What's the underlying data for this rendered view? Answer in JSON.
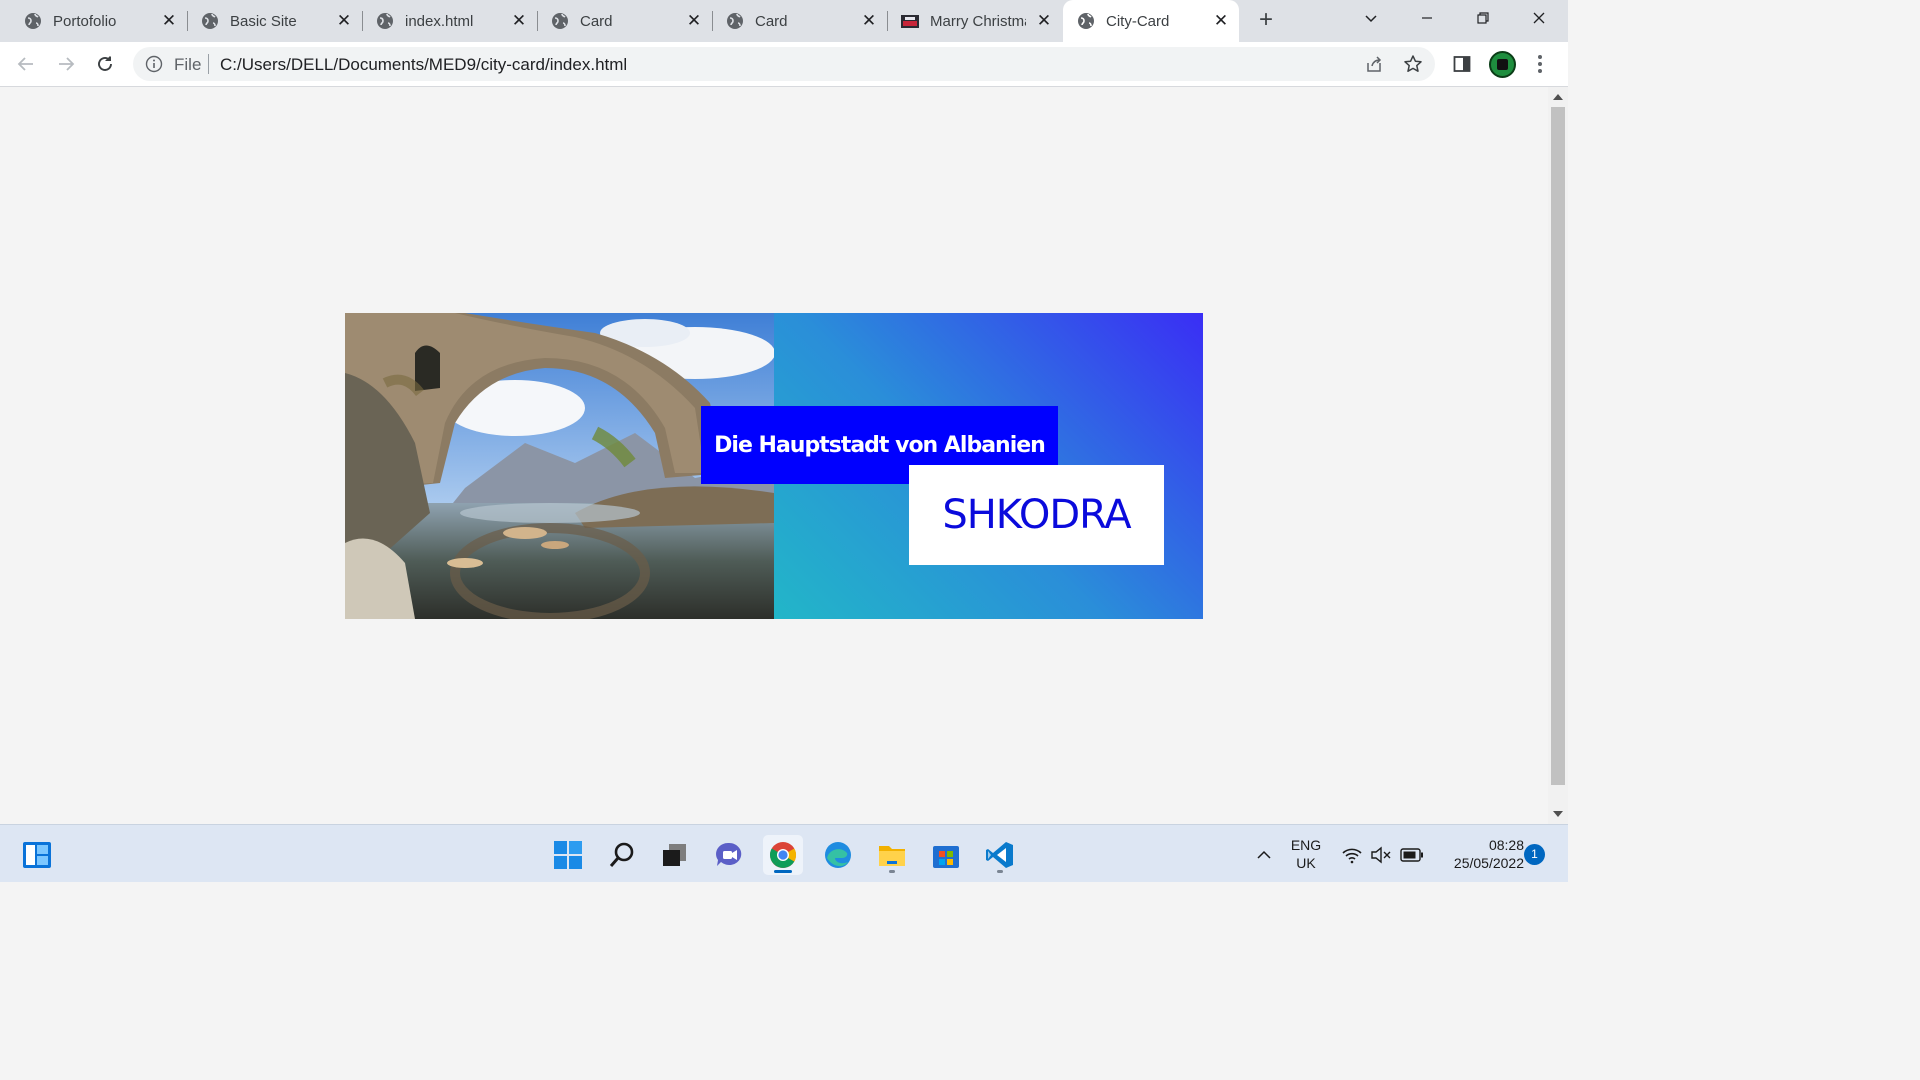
{
  "browser": {
    "tabs": [
      {
        "title": "Portofolio",
        "icon": "globe-icon"
      },
      {
        "title": "Basic Site",
        "icon": "globe-icon"
      },
      {
        "title": "index.html",
        "icon": "globe-icon"
      },
      {
        "title": "Card",
        "icon": "globe-icon"
      },
      {
        "title": "Card",
        "icon": "globe-icon"
      },
      {
        "title": "Marry Christmas",
        "icon": "christmas-thumbnail-icon"
      },
      {
        "title": "City-Card",
        "icon": "globe-icon",
        "active": true
      }
    ],
    "new_tab_label": "+",
    "close_glyph": "✕",
    "address": {
      "scheme": "File",
      "url": "C:/Users/DELL/Documents/MED9/city-card/index.html"
    }
  },
  "page": {
    "card": {
      "subtitle": "Die Hauptstadt von Albanien",
      "city": "SHKODRA",
      "photo_description_icon": "stone-bridge-photo"
    },
    "colors": {
      "subtitle_bg": "#0000ff",
      "city_text": "#0a0adc",
      "gradient_start": "#22b6c8",
      "gradient_end": "#3a2ef5",
      "page_bg": "#f4f4f4"
    }
  },
  "taskbar": {
    "language": "ENG",
    "region": "UK",
    "time": "08:28",
    "date": "25/05/2022",
    "notifications": "1"
  }
}
